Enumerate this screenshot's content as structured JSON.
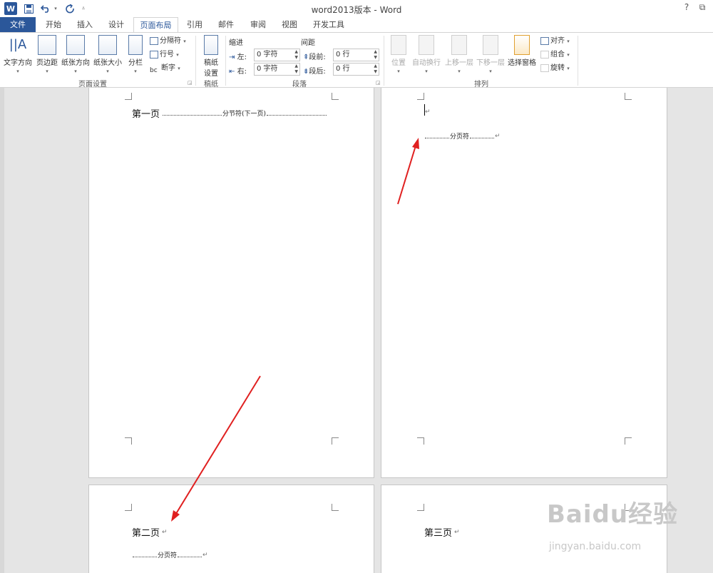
{
  "app": {
    "title": "word2013版本 - Word",
    "help_label": "?",
    "restore_label": "⧉"
  },
  "qat": {
    "logo_label": "W",
    "save_icon": "save-icon",
    "undo_icon": "undo-icon",
    "redo_icon": "redo-icon",
    "customize_icon": "customize-icon"
  },
  "tabs": [
    {
      "label": "文件"
    },
    {
      "label": "开始"
    },
    {
      "label": "插入"
    },
    {
      "label": "设计"
    },
    {
      "label": "页面布局"
    },
    {
      "label": "引用"
    },
    {
      "label": "邮件"
    },
    {
      "label": "审阅"
    },
    {
      "label": "视图"
    },
    {
      "label": "开发工具"
    }
  ],
  "ribbon": {
    "page_setup": {
      "text_direction": "文字方向",
      "margins": "页边距",
      "orientation": "纸张方向",
      "size": "纸张大小",
      "columns": "分栏",
      "breaks": "分隔符",
      "line_numbers": "行号",
      "hyphenation": "断字",
      "group_label": "页面设置"
    },
    "manuscript": {
      "settings": "稿纸\n设置",
      "settings_line1": "稿纸",
      "settings_line2": "设置",
      "group_label": "稿纸"
    },
    "paragraph": {
      "indent_label": "缩进",
      "spacing_label": "间距",
      "left_label": "左:",
      "right_label": "右:",
      "before_label": "段前:",
      "after_label": "段后:",
      "left_value": "0 字符",
      "right_value": "0 字符",
      "before_value": "0 行",
      "after_value": "0 行",
      "group_label": "段落"
    },
    "arrange": {
      "position": "位置",
      "wrap_text": "自动换行",
      "bring_forward": "上移一层",
      "send_backward": "下移一层",
      "selection_pane": "选择窗格",
      "align": "对齐",
      "group": "组合",
      "rotate": "旋转",
      "group_label": "排列"
    }
  },
  "document": {
    "page1_text": "第一页",
    "section_break": "分节符(下一页)",
    "page_break": "分页符",
    "page2_text": "第二页",
    "page3_text": "第三页",
    "para_mark": "↵"
  },
  "watermark": {
    "brand": "Baidu经验",
    "url": "jingyan.baidu.com"
  },
  "colors": {
    "accent": "#2b579a",
    "annotation_arrow": "#e02020"
  }
}
